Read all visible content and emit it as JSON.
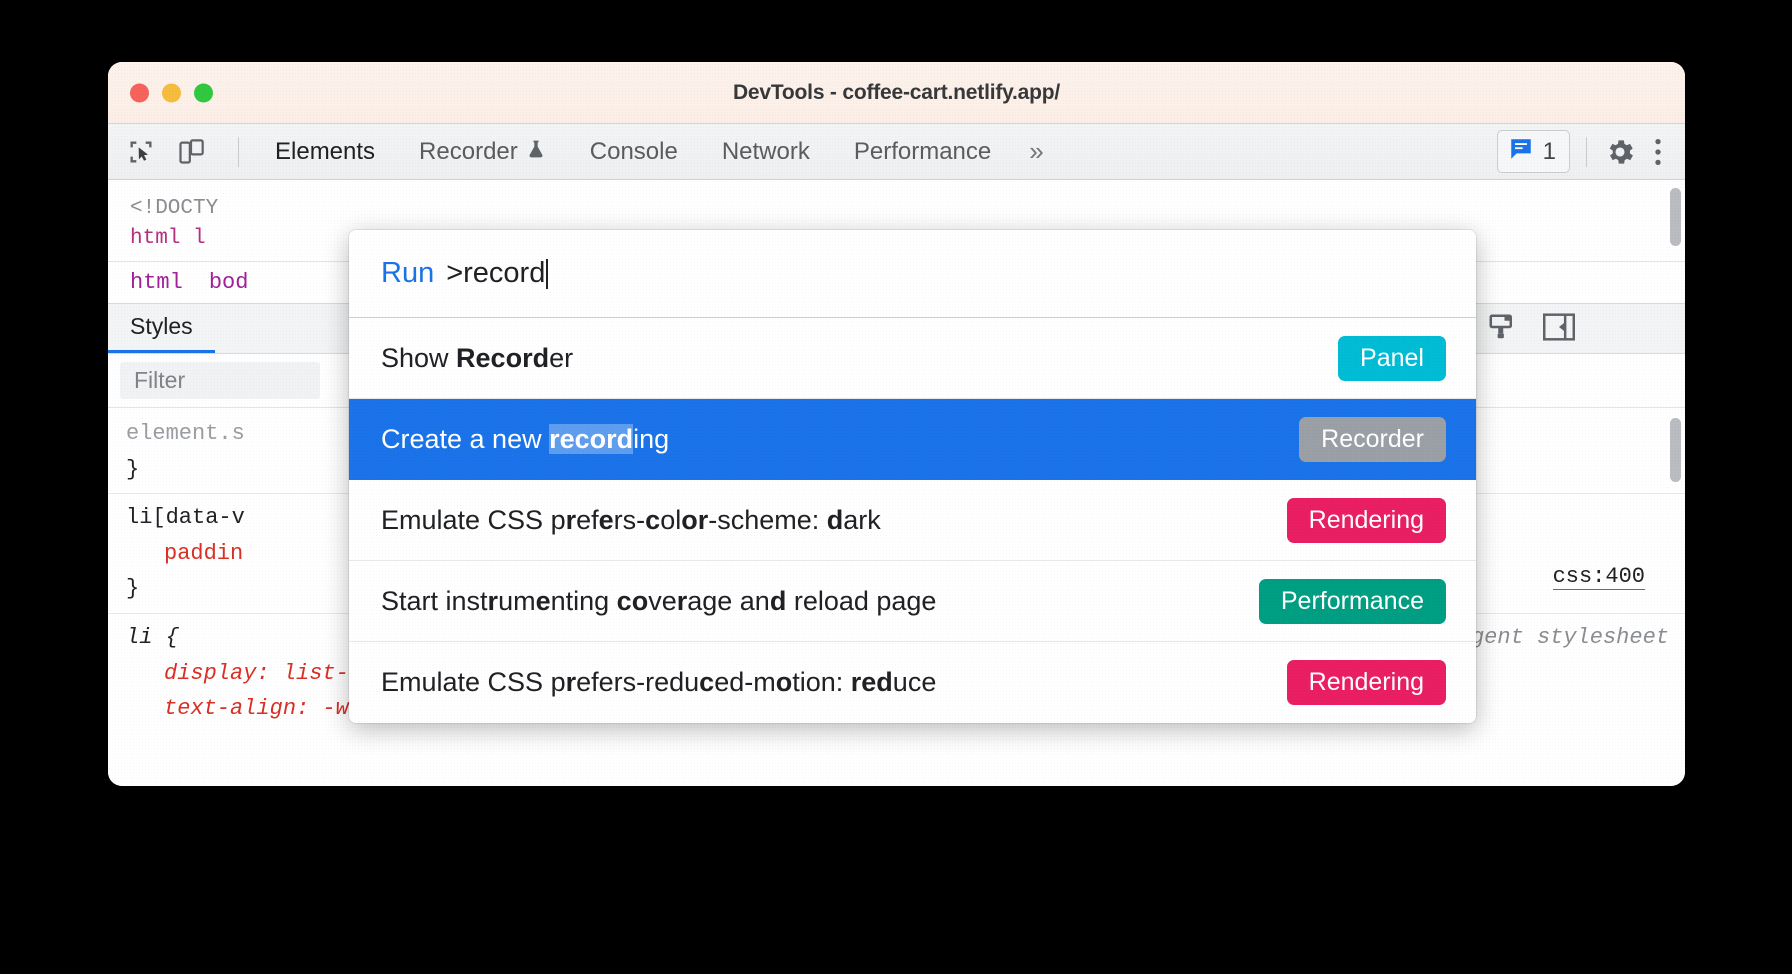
{
  "window": {
    "title": "DevTools - coffee-cart.netlify.app/",
    "traffic_lights": [
      "close",
      "minimize",
      "maximize"
    ]
  },
  "toolbar": {
    "inspect_icon": "inspect-element-icon",
    "device_icon": "device-toolbar-icon",
    "tabs": [
      {
        "label": "Elements",
        "active": true,
        "experimental": false
      },
      {
        "label": "Recorder",
        "active": false,
        "experimental": true
      },
      {
        "label": "Console",
        "active": false,
        "experimental": false
      },
      {
        "label": "Network",
        "active": false,
        "experimental": false
      },
      {
        "label": "Performance",
        "active": false,
        "experimental": false
      }
    ],
    "more_tabs_glyph": "»",
    "messages": {
      "icon": "message-bubble-icon",
      "count": "1"
    },
    "settings_icon": "gear-icon",
    "menu_icon": "three-dot-menu-icon"
  },
  "elements_panel": {
    "tree_line1": "<!DOCTY",
    "tree_line2": "html l",
    "breadcrumbs": [
      "html",
      "bod"
    ]
  },
  "styles_panel": {
    "tab_label": "Styles",
    "filter_placeholder": "Filter",
    "icons": [
      "new-style-rule-icon",
      "toggle-sidebar-icon"
    ],
    "rules": [
      {
        "selector": "element.s",
        "close": "}"
      },
      {
        "selector": "li[data-v",
        "declaration": "paddin",
        "close": "}"
      },
      {
        "selector": "li {",
        "source": "user agent stylesheet",
        "declarations": [
          "display: list-item;",
          "text-align: -webkit-match-parent;"
        ]
      }
    ],
    "source_right_label": "css:400"
  },
  "command_palette": {
    "prefix_label": "Run",
    "query": ">record",
    "items": [
      {
        "parts": [
          {
            "t": "Show ",
            "b": false
          },
          {
            "t": "Record",
            "b": true
          },
          {
            "t": "er",
            "b": false
          }
        ],
        "badge": "Panel",
        "badge_color": "#00bcd4",
        "selected": false
      },
      {
        "parts": [
          {
            "t": "Create a new ",
            "b": false
          },
          {
            "t": "record",
            "b": true
          },
          {
            "t": "ing",
            "b": false
          }
        ],
        "badge": "Recorder",
        "badge_color": "#9aa0a6",
        "selected": true
      },
      {
        "parts": [
          {
            "t": "Emulate CSS p",
            "b": false
          },
          {
            "t": "r",
            "b": true
          },
          {
            "t": "ef",
            "b": false
          },
          {
            "t": "e",
            "b": true
          },
          {
            "t": "rs-",
            "b": false
          },
          {
            "t": "c",
            "b": true
          },
          {
            "t": "ol",
            "b": false
          },
          {
            "t": "or",
            "b": true
          },
          {
            "t": "-scheme: ",
            "b": false
          },
          {
            "t": "d",
            "b": true
          },
          {
            "t": "ark",
            "b": false
          }
        ],
        "badge": "Rendering",
        "badge_color": "#e91e63",
        "selected": false
      },
      {
        "parts": [
          {
            "t": "Start inst",
            "b": false
          },
          {
            "t": "r",
            "b": true
          },
          {
            "t": "um",
            "b": false
          },
          {
            "t": "e",
            "b": true
          },
          {
            "t": "nting ",
            "b": false
          },
          {
            "t": "co",
            "b": true
          },
          {
            "t": "ve",
            "b": false
          },
          {
            "t": "r",
            "b": true
          },
          {
            "t": "age an",
            "b": false
          },
          {
            "t": "d",
            "b": true
          },
          {
            "t": " reload page",
            "b": false
          }
        ],
        "badge": "Performance",
        "badge_color": "#009e82",
        "selected": false
      },
      {
        "parts": [
          {
            "t": "Emulate CSS p",
            "b": false
          },
          {
            "t": "r",
            "b": true
          },
          {
            "t": "efers-redu",
            "b": false
          },
          {
            "t": "c",
            "b": true
          },
          {
            "t": "ed-m",
            "b": false
          },
          {
            "t": "o",
            "b": true
          },
          {
            "t": "tion: ",
            "b": false
          },
          {
            "t": "red",
            "b": true
          },
          {
            "t": "uce",
            "b": false
          }
        ],
        "badge": "Rendering",
        "badge_color": "#e91e63",
        "selected": false
      }
    ]
  },
  "colors": {
    "accent_blue": "#1a73e8",
    "titlebar": "#fbeee6",
    "panel_bg": "#f3f4f5"
  }
}
